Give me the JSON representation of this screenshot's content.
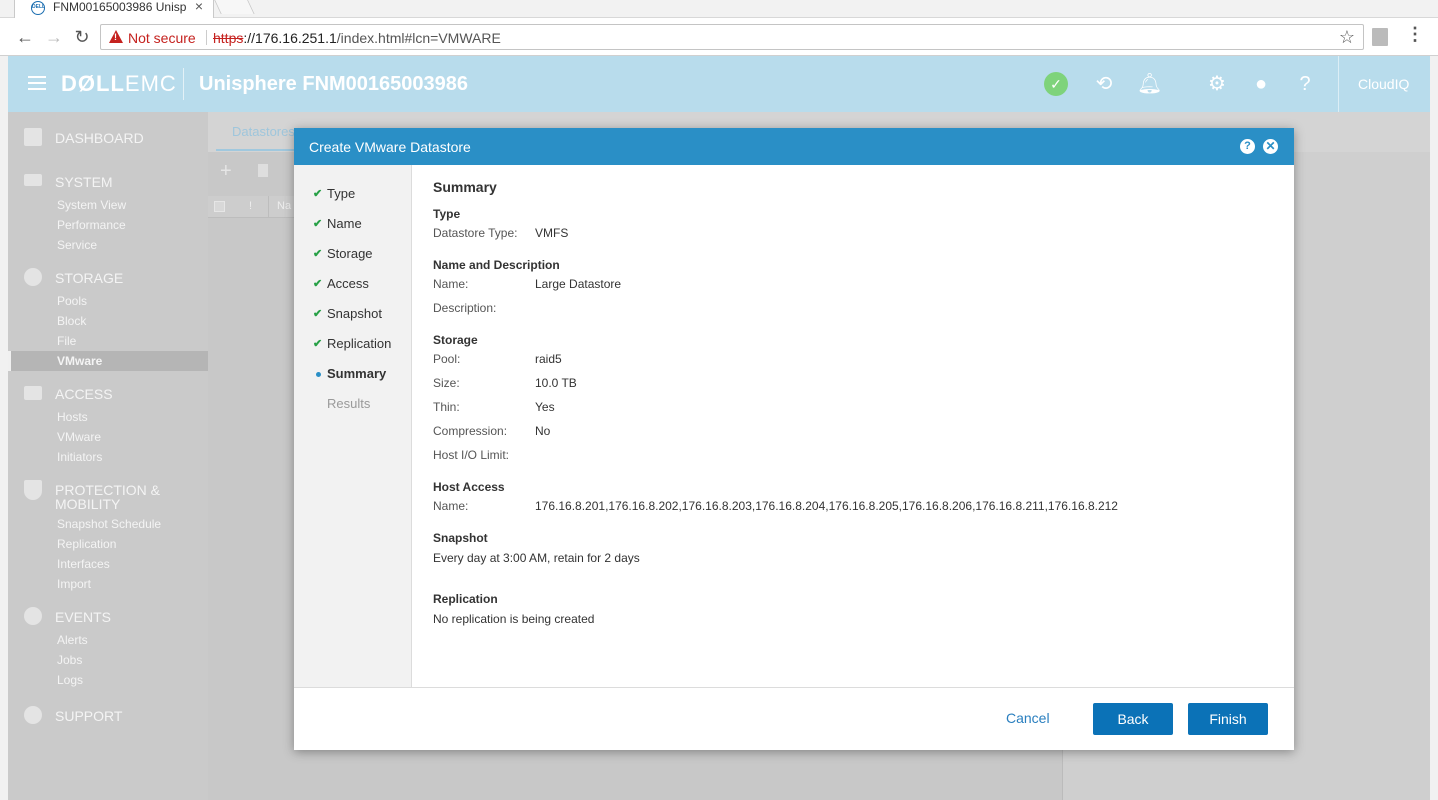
{
  "browser": {
    "tab_title": "FNM00165003986 Unisp",
    "not_secure": "Not secure",
    "url_scheme": "https",
    "url_host": "://176.16.251.1",
    "url_path": "/index.html#lcn=VMWARE"
  },
  "header": {
    "logo_bold": "DØLL",
    "logo_light": "EMC",
    "title": "Unisphere FNM00165003986",
    "cloudiq": "CloudIQ",
    "icons": [
      "status-ok-icon",
      "history-icon",
      "alerts-bell-icon",
      "gear-icon",
      "user-icon",
      "help-icon"
    ]
  },
  "sidebar": {
    "dashboard": "DASHBOARD",
    "system": {
      "label": "SYSTEM",
      "items": [
        "System View",
        "Performance",
        "Service"
      ]
    },
    "storage": {
      "label": "STORAGE",
      "items": [
        "Pools",
        "Block",
        "File",
        "VMware"
      ]
    },
    "access": {
      "label": "ACCESS",
      "items": [
        "Hosts",
        "VMware",
        "Initiators"
      ]
    },
    "protection": {
      "label_line1": "PROTECTION &",
      "label_line2": "MOBILITY",
      "items": [
        "Snapshot Schedule",
        "Replication",
        "Interfaces",
        "Import"
      ]
    },
    "events": {
      "label": "EVENTS",
      "items": [
        "Alerts",
        "Jobs",
        "Logs"
      ]
    },
    "support": "SUPPORT"
  },
  "main": {
    "tabs": [
      "Datastores"
    ],
    "grid_col_flag": "!",
    "grid_col_name": "Na"
  },
  "modal": {
    "title": "Create VMware Datastore",
    "steps": [
      {
        "label": "Type",
        "state": "done"
      },
      {
        "label": "Name",
        "state": "done"
      },
      {
        "label": "Storage",
        "state": "done"
      },
      {
        "label": "Access",
        "state": "done"
      },
      {
        "label": "Snapshot",
        "state": "done"
      },
      {
        "label": "Replication",
        "state": "done"
      },
      {
        "label": "Summary",
        "state": "current"
      },
      {
        "label": "Results",
        "state": "pending"
      }
    ],
    "check_glyph": "✔",
    "summary": {
      "title": "Summary",
      "type_heading": "Type",
      "datastore_type_label": "Datastore Type:",
      "datastore_type_value": "VMFS",
      "name_heading": "Name and Description",
      "name_label": "Name:",
      "name_value": "Large Datastore",
      "description_label": "Description:",
      "storage_heading": "Storage",
      "pool_label": "Pool:",
      "pool_value": "raid5",
      "size_label": "Size:",
      "size_value": "10.0 TB",
      "thin_label": "Thin:",
      "thin_value": "Yes",
      "compression_label": "Compression:",
      "compression_value": "No",
      "host_io_label": "Host I/O Limit:",
      "host_access_heading": "Host Access",
      "host_name_label": "Name:",
      "host_name_value": "176.16.8.201,176.16.8.202,176.16.8.203,176.16.8.204,176.16.8.205,176.16.8.206,176.16.8.211,176.16.8.212",
      "snapshot_heading": "Snapshot",
      "snapshot_value": "Every day at 3:00 AM, retain for 2 days",
      "replication_heading": "Replication",
      "replication_value": "No replication is being created"
    },
    "buttons": {
      "cancel": "Cancel",
      "back": "Back",
      "finish": "Finish"
    }
  },
  "colors": {
    "header_bg": "#b8dcec",
    "modal_header": "#2a8fc6",
    "primary_button": "#0b72b7",
    "check_green": "#27a046"
  }
}
